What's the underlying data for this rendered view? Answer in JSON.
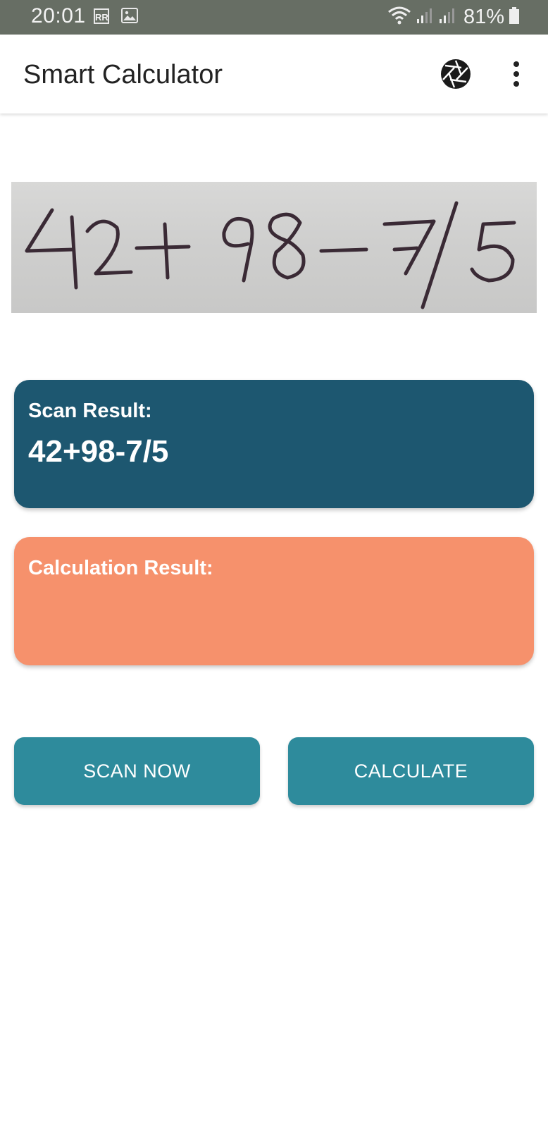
{
  "status_bar": {
    "time": "20:01",
    "rr_badge": "RR",
    "battery": "81%"
  },
  "app_bar": {
    "title": "Smart Calculator",
    "icons": [
      "aperture-icon",
      "more-vert-icon"
    ]
  },
  "scan_image": {
    "handwritten_text": "42+98-7/5"
  },
  "scan_card": {
    "label": "Scan Result:",
    "value": "42+98-7/5",
    "color": "#1d5770"
  },
  "calc_card": {
    "label": "Calculation Result:",
    "value": "",
    "color": "#f6916c"
  },
  "buttons": {
    "scan_label": "SCAN NOW",
    "calculate_label": "CALCULATE",
    "color": "#2e8b9c"
  }
}
